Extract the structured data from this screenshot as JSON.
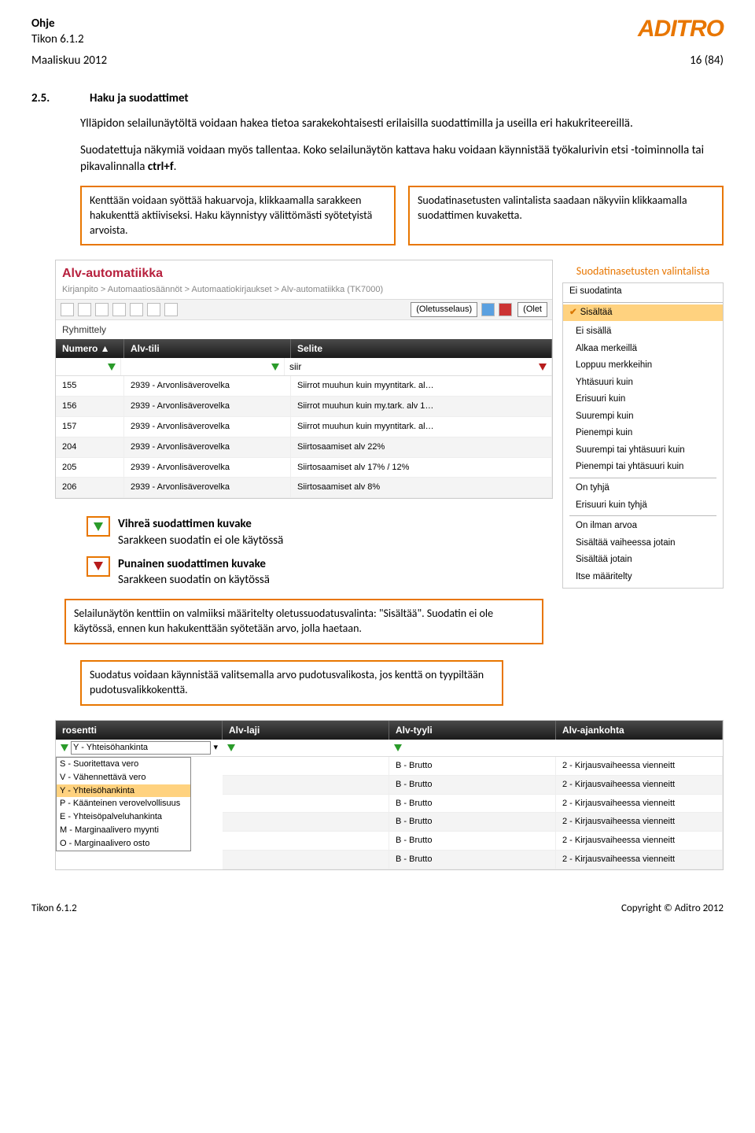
{
  "header": {
    "title": "Ohje",
    "subtitle": "Tikon 6.1.2",
    "logo": "ADITRO"
  },
  "dateLine": {
    "left": "Maaliskuu 2012",
    "right": "16 (84)"
  },
  "section": {
    "num": "2.5.",
    "title": "Haku ja suodattimet"
  },
  "para1": "Ylläpidon selailunäytöltä voidaan hakea tietoa sarakekohtaisesti erilaisilla suodattimilla ja useilla eri hakukriteereillä.",
  "para2a": "Suodatettuja näkymiä voidaan myös tallentaa. Koko selailunäytön kattava haku voidaan käynnistää työkalurivin etsi -toiminnolla tai pikavalinnalla ",
  "para2b": "ctrl+f",
  "para2c": ".",
  "box1": "Kenttään voidaan syöttää hakuarvoja, klikkaamalla sarakkeen hakukenttä aktiiviseksi. Haku käynnistyy välittömästi syötetyistä arvoista.",
  "box2": "Suodatinasetusten valintalista saadaan näkyviin klikkaamalla suodattimen kuvaketta.",
  "rightLabel": "Suodatinasetusten valintalista",
  "panel": {
    "title": "Alv-automatiikka",
    "crumb": "Kirjanpito > Automaatiosäännöt > Automaatiokirjaukset > Alv-automatiikka  (TK7000)",
    "browse": "(Oletusselaus)",
    "browse2": "(Olet",
    "group": "Ryhmittely",
    "cols": [
      "Numero ▲",
      "Alv-tili",
      "Selite"
    ],
    "filterInput": "siir",
    "rows": [
      {
        "n": "155",
        "t": "2939 - Arvonlisäverovelka",
        "s": "Siirrot muuhun kuin myyntitark. al…"
      },
      {
        "n": "156",
        "t": "2939 - Arvonlisäverovelka",
        "s": "Siirrot muuhun kuin my.tark. alv 1…"
      },
      {
        "n": "157",
        "t": "2939 - Arvonlisäverovelka",
        "s": "Siirrot muuhun kuin myyntitark. al…"
      },
      {
        "n": "204",
        "t": "2939 - Arvonlisäverovelka",
        "s": "Siirtosaamiset alv 22%"
      },
      {
        "n": "205",
        "t": "2939 - Arvonlisäverovelka",
        "s": "Siirtosaamiset alv 17% / 12%"
      },
      {
        "n": "206",
        "t": "2939 - Arvonlisäverovelka",
        "s": "Siirtosaamiset alv 8%"
      }
    ]
  },
  "filterList": {
    "top": "Ei suodatinta",
    "checked": "Sisältää",
    "items": [
      "Ei sisällä",
      "Alkaa merkeillä",
      "Loppuu merkkeihin",
      "Yhtäsuuri kuin",
      "Erisuuri kuin",
      "Suurempi kuin",
      "Pienempi kuin",
      "Suurempi tai yhtäsuuri kuin",
      "Pienempi tai yhtäsuuri kuin",
      "On tyhjä",
      "Erisuuri kuin tyhjä",
      "On ilman arvoa",
      "Sisältää vaiheessa jotain",
      "Sisältää jotain",
      "Itse määritelty"
    ]
  },
  "legend": {
    "green": {
      "h": "Vihreä suodattimen kuvake",
      "t": "Sarakkeen suodatin ei ole käytössä"
    },
    "red": {
      "h": "Punainen suodattimen kuvake",
      "t": "Sarakkeen suodatin on käytössä"
    }
  },
  "box3": "Selailunäytön kenttiin on valmiiksi määritelty oletussuodatusvalinta: \"Sisältää\". Suodatin ei ole käytössä, ennen kun hakukenttään syötetään arvo, jolla haetaan.",
  "box4": "Suodatus voidaan käynnistää valitsemalla arvo pudotusvalikosta, jos kenttä on tyypiltään pudotusvalikkokenttä.",
  "table2": {
    "cols": [
      "rosentti",
      "Alv-laji",
      "Alv-tyyli",
      "Alv-ajankohta"
    ],
    "ddSel": "Y - Yhteisöhankinta",
    "ddOpts": [
      "S - Suoritettava vero",
      "V - Vähennettävä vero",
      "Y - Yhteisöhankinta",
      "P - Käänteinen verovelvollisuus",
      "E - Yhteisöpalveluhankinta",
      "M - Marginaalivero myynti",
      "O - Marginaalivero osto"
    ],
    "ddHl": 2,
    "tyyli": "B - Brutto",
    "ajan": "2 - Kirjausvaiheessa vienneitt"
  },
  "footer": {
    "left": "Tikon 6.1.2",
    "right": "Copyright © Aditro 2012"
  }
}
